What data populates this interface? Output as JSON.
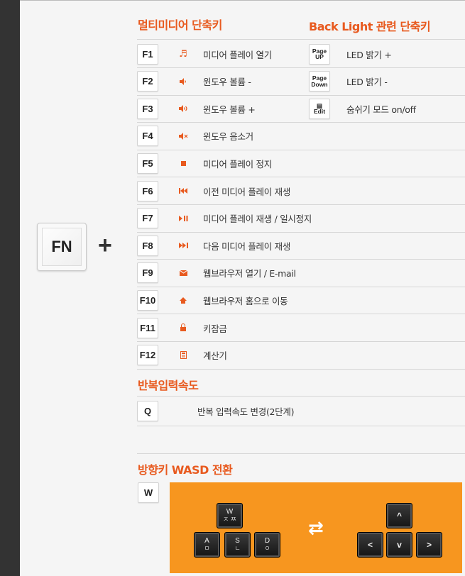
{
  "fn_key": "FN",
  "plus": "+",
  "sections": {
    "multimedia_title": "멀티미디어 단축키",
    "backlight_title": "Back Light 관련 단축키",
    "repeat_title": "반복입력속도",
    "wasd_title": "방향키 WASD 전환"
  },
  "multimedia": [
    {
      "key": "F1",
      "icon": "music-note-icon",
      "label": "미디어 플레이 열기"
    },
    {
      "key": "F2",
      "icon": "volume-down-icon",
      "label": "윈도우 볼륨 -"
    },
    {
      "key": "F3",
      "icon": "volume-up-icon",
      "label": "윈도우 볼륨 +"
    },
    {
      "key": "F4",
      "icon": "mute-icon",
      "label": "윈도우 음소거"
    },
    {
      "key": "F5",
      "icon": "stop-icon",
      "label": "미디어 플레이 정지"
    },
    {
      "key": "F6",
      "icon": "previous-track-icon",
      "label": "이전 미디어 플레이 재생"
    },
    {
      "key": "F7",
      "icon": "play-pause-icon",
      "label": "미디어 플레이 재생 / 일시정지"
    },
    {
      "key": "F8",
      "icon": "next-track-icon",
      "label": "다음 미디어 플레이 재생"
    },
    {
      "key": "F9",
      "icon": "mail-icon",
      "label": "웹브라우저 열기 / E-mail"
    },
    {
      "key": "F10",
      "icon": "home-icon",
      "label": "웹브라우저 홈으로 이동"
    },
    {
      "key": "F11",
      "icon": "lock-icon",
      "label": "키잠금"
    },
    {
      "key": "F12",
      "icon": "calculator-icon",
      "label": "계산기"
    }
  ],
  "backlight": [
    {
      "key_line1": "Page",
      "key_line2": "UP",
      "label": "LED 밝기 +"
    },
    {
      "key_line1": "Page",
      "key_line2": "Down",
      "label": "LED 밝기 -"
    },
    {
      "key_line1": "▤",
      "key_line2": "Edit",
      "label": "숨쉬기 모드 on/off"
    }
  ],
  "repeat": {
    "key": "Q",
    "label": "반복 입력속도 변경(2단계)"
  },
  "wasd": {
    "key": "W",
    "swap_symbol": "⇄",
    "left_keys": [
      {
        "letter": "W",
        "sub": "ㅈ ㅉ"
      },
      {
        "letter": "A",
        "sub": "ㅁ"
      },
      {
        "letter": "S",
        "sub": "ㄴ"
      },
      {
        "letter": "D",
        "sub": "ㅇ"
      }
    ],
    "right_keys": [
      {
        "arrow": "^"
      },
      {
        "arrow": "<"
      },
      {
        "arrow": "v"
      },
      {
        "arrow": ">"
      }
    ]
  },
  "colors": {
    "accent": "#e85a1f",
    "orange_box": "#f7961f",
    "sidebar": "#333333"
  }
}
